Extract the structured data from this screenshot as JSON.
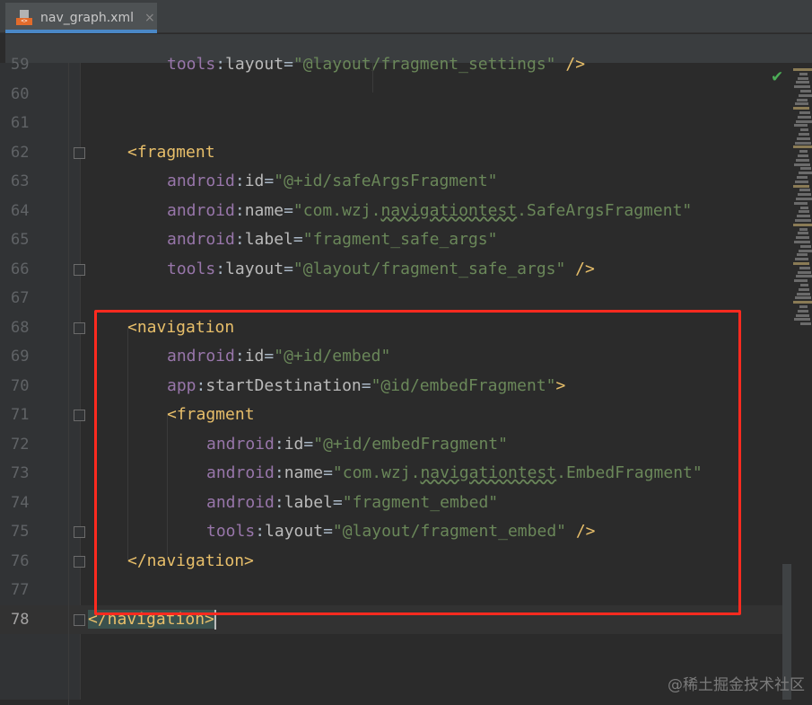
{
  "tab": {
    "title": "nav_graph.xml",
    "icon": "xml-file-icon",
    "close_icon": "×"
  },
  "status": {
    "icon": "check-icon",
    "glyph": "✔",
    "color": "#4cad57"
  },
  "current_line": 78,
  "lines": [
    {
      "num": "59",
      "indent": 8,
      "tokens": [
        {
          "t": "tools",
          "c": "ns"
        },
        {
          "t": ":",
          "c": "punc"
        },
        {
          "t": "layout",
          "c": "attr"
        },
        {
          "t": "=",
          "c": "punc"
        },
        {
          "t": "\"@layout/fragment_settings\"",
          "c": "val"
        },
        {
          "t": " />",
          "c": "tag"
        }
      ]
    },
    {
      "num": "60",
      "indent": 0,
      "tokens": []
    },
    {
      "num": "61",
      "indent": 0,
      "tokens": []
    },
    {
      "num": "62",
      "indent": 4,
      "fold": true,
      "tokens": [
        {
          "t": "<fragment",
          "c": "tag"
        }
      ]
    },
    {
      "num": "63",
      "indent": 8,
      "tokens": [
        {
          "t": "android",
          "c": "ns"
        },
        {
          "t": ":",
          "c": "punc"
        },
        {
          "t": "id",
          "c": "attr"
        },
        {
          "t": "=",
          "c": "punc"
        },
        {
          "t": "\"@+id/safeArgsFragment\"",
          "c": "val"
        }
      ]
    },
    {
      "num": "64",
      "indent": 8,
      "tokens": [
        {
          "t": "android",
          "c": "ns"
        },
        {
          "t": ":",
          "c": "punc"
        },
        {
          "t": "name",
          "c": "attr"
        },
        {
          "t": "=",
          "c": "punc"
        },
        {
          "t": "\"com.wzj.",
          "c": "val"
        },
        {
          "t": "navigationtest",
          "c": "wavy"
        },
        {
          "t": ".SafeArgsFragment\"",
          "c": "val"
        }
      ]
    },
    {
      "num": "65",
      "indent": 8,
      "tokens": [
        {
          "t": "android",
          "c": "ns"
        },
        {
          "t": ":",
          "c": "punc"
        },
        {
          "t": "label",
          "c": "attr"
        },
        {
          "t": "=",
          "c": "punc"
        },
        {
          "t": "\"fragment_safe_args\"",
          "c": "val"
        }
      ]
    },
    {
      "num": "66",
      "indent": 8,
      "fold": true,
      "tokens": [
        {
          "t": "tools",
          "c": "ns"
        },
        {
          "t": ":",
          "c": "punc"
        },
        {
          "t": "layout",
          "c": "attr"
        },
        {
          "t": "=",
          "c": "punc"
        },
        {
          "t": "\"@layout/fragment_safe_args\"",
          "c": "val"
        },
        {
          "t": " />",
          "c": "tag"
        }
      ]
    },
    {
      "num": "67",
      "indent": 0,
      "tokens": []
    },
    {
      "num": "68",
      "indent": 4,
      "fold": true,
      "tokens": [
        {
          "t": "<navigation",
          "c": "tag"
        }
      ]
    },
    {
      "num": "69",
      "indent": 8,
      "tokens": [
        {
          "t": "android",
          "c": "ns"
        },
        {
          "t": ":",
          "c": "punc"
        },
        {
          "t": "id",
          "c": "attr"
        },
        {
          "t": "=",
          "c": "punc"
        },
        {
          "t": "\"@+id/embed\"",
          "c": "val"
        }
      ]
    },
    {
      "num": "70",
      "indent": 8,
      "tokens": [
        {
          "t": "app",
          "c": "ns"
        },
        {
          "t": ":",
          "c": "punc"
        },
        {
          "t": "startDestination",
          "c": "attr"
        },
        {
          "t": "=",
          "c": "punc"
        },
        {
          "t": "\"@id/embedFragment\"",
          "c": "val"
        },
        {
          "t": ">",
          "c": "tag"
        }
      ]
    },
    {
      "num": "71",
      "indent": 8,
      "fold": true,
      "tokens": [
        {
          "t": "<fragment",
          "c": "tag"
        }
      ]
    },
    {
      "num": "72",
      "indent": 12,
      "tokens": [
        {
          "t": "android",
          "c": "ns"
        },
        {
          "t": ":",
          "c": "punc"
        },
        {
          "t": "id",
          "c": "attr"
        },
        {
          "t": "=",
          "c": "punc"
        },
        {
          "t": "\"@+id/embedFragment\"",
          "c": "val"
        }
      ]
    },
    {
      "num": "73",
      "indent": 12,
      "tokens": [
        {
          "t": "android",
          "c": "ns"
        },
        {
          "t": ":",
          "c": "punc"
        },
        {
          "t": "name",
          "c": "attr"
        },
        {
          "t": "=",
          "c": "punc"
        },
        {
          "t": "\"com.wzj.",
          "c": "val"
        },
        {
          "t": "navigationtest",
          "c": "wavy"
        },
        {
          "t": ".EmbedFragment\"",
          "c": "val"
        }
      ]
    },
    {
      "num": "74",
      "indent": 12,
      "tokens": [
        {
          "t": "android",
          "c": "ns"
        },
        {
          "t": ":",
          "c": "punc"
        },
        {
          "t": "label",
          "c": "attr"
        },
        {
          "t": "=",
          "c": "punc"
        },
        {
          "t": "\"fragment_embed\"",
          "c": "val"
        }
      ]
    },
    {
      "num": "75",
      "indent": 12,
      "fold": true,
      "tokens": [
        {
          "t": "tools",
          "c": "ns"
        },
        {
          "t": ":",
          "c": "punc"
        },
        {
          "t": "layout",
          "c": "attr"
        },
        {
          "t": "=",
          "c": "punc"
        },
        {
          "t": "\"@layout/fragment_embed\"",
          "c": "val"
        },
        {
          "t": " />",
          "c": "tag"
        }
      ]
    },
    {
      "num": "76",
      "indent": 4,
      "fold": true,
      "tokens": [
        {
          "t": "</navigation>",
          "c": "tag"
        }
      ]
    },
    {
      "num": "77",
      "indent": 0,
      "tokens": []
    },
    {
      "num": "78",
      "indent": 0,
      "fold": true,
      "tokens": [
        {
          "t": "</navigation>",
          "c": "tag",
          "hl": true
        }
      ]
    }
  ],
  "annotation": {
    "color": "#ff2a1f",
    "highlighted_lines": [
      "68",
      "77"
    ]
  },
  "watermark": "@稀土掘金技术社区"
}
